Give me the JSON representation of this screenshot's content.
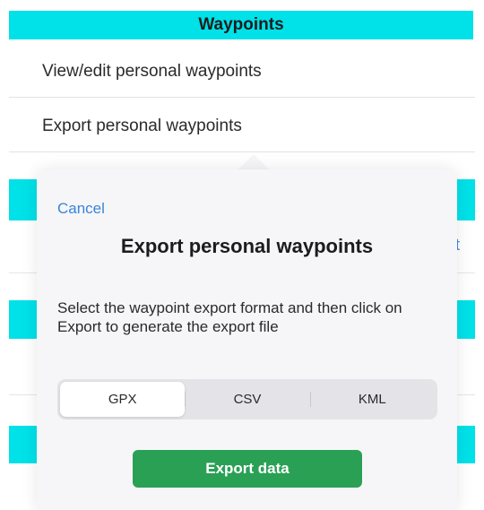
{
  "header": {
    "title": "Waypoints"
  },
  "list": {
    "items": [
      {
        "label": "View/edit personal waypoints"
      },
      {
        "label": "Export personal waypoints"
      }
    ],
    "partial_char": "t"
  },
  "popover": {
    "cancel_label": "Cancel",
    "title": "Export personal waypoints",
    "description": "Select the waypoint export format and then click on Export to generate the export file",
    "formats": {
      "options": [
        "GPX",
        "CSV",
        "KML"
      ],
      "selected": "GPX"
    },
    "export_button_label": "Export data"
  },
  "colors": {
    "header_accent": "#00e1e8",
    "link_blue": "#3a84d9",
    "button_green": "#2aa055"
  }
}
